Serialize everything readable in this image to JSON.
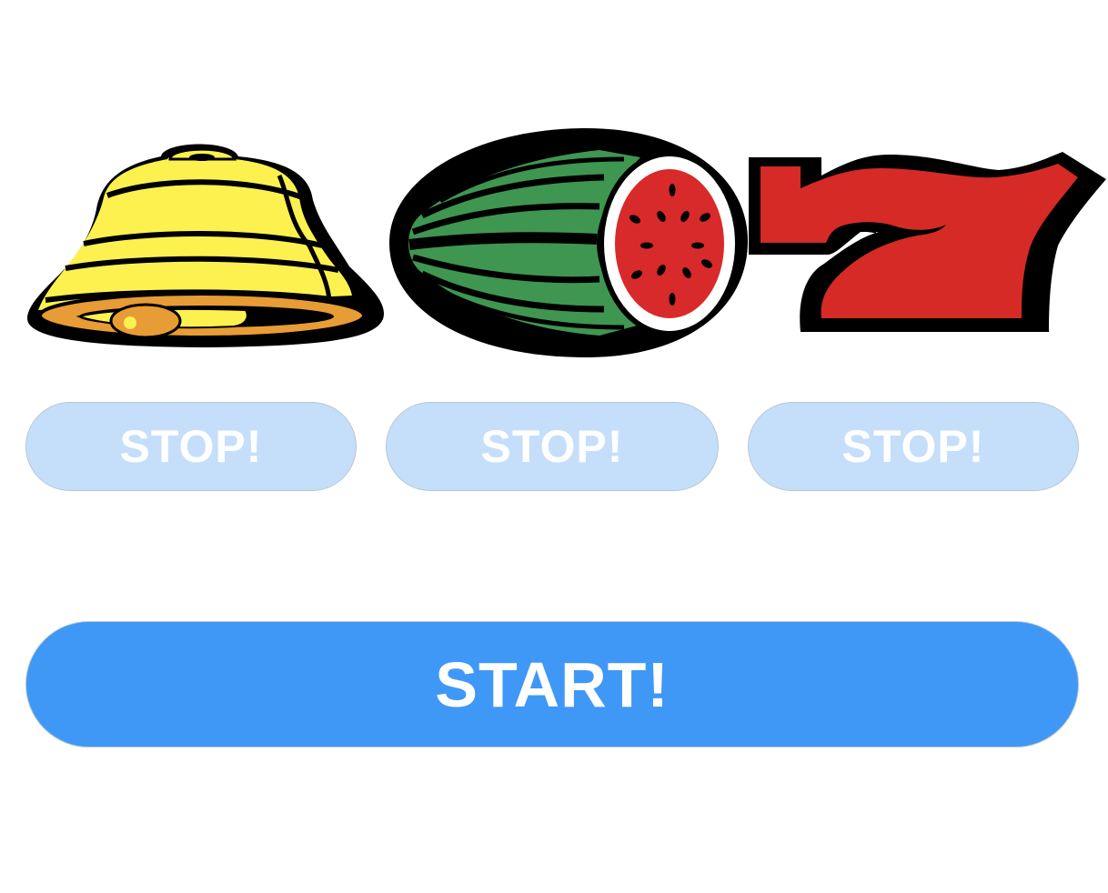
{
  "reels": [
    {
      "symbol": "bell-icon",
      "colors": {
        "primary": "#fdf14f",
        "rim": "#e89c35",
        "outline": "#000000"
      }
    },
    {
      "symbol": "watermelon-icon",
      "colors": {
        "rind": "#3f9651",
        "flesh": "#d82a2a",
        "outline": "#000000"
      }
    },
    {
      "symbol": "seven-icon",
      "colors": {
        "primary": "#d52a25",
        "outline": "#000000"
      }
    }
  ],
  "stop_buttons": [
    {
      "label": "STOP!"
    },
    {
      "label": "STOP!"
    },
    {
      "label": "STOP!"
    }
  ],
  "start_button": {
    "label": "START!"
  },
  "colors": {
    "stop_bg": "#c5dffa",
    "start_bg": "#3f98f6",
    "button_text": "#ffffff"
  }
}
